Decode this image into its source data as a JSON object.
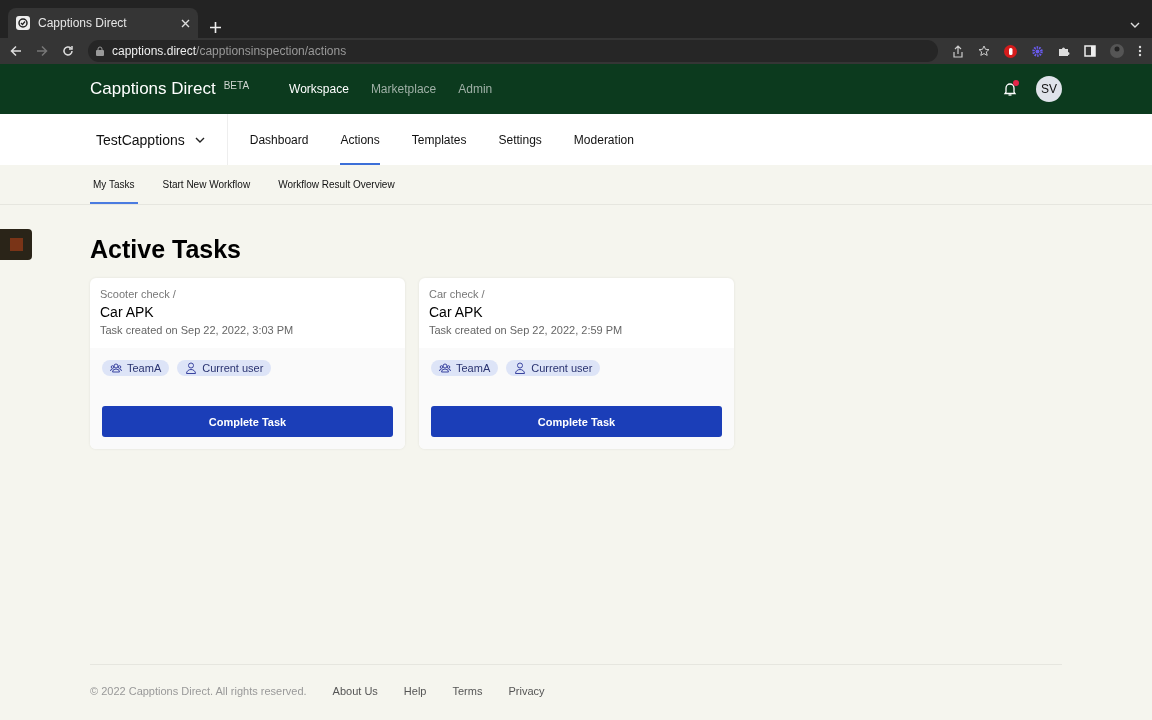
{
  "browser": {
    "tab_title": "Capptions Direct",
    "url_host": "capptions.direct",
    "url_path": "/capptionsinspection/actions"
  },
  "header": {
    "brand": "Capptions Direct",
    "badge": "BETA",
    "nav": [
      {
        "label": "Workspace",
        "selected": true
      },
      {
        "label": "Marketplace",
        "selected": false
      },
      {
        "label": "Admin",
        "selected": false
      }
    ],
    "notification_unread": true,
    "avatar": "SV"
  },
  "org": {
    "name": "TestCapptions"
  },
  "tabs": [
    {
      "label": "Dashboard",
      "selected": false
    },
    {
      "label": "Actions",
      "selected": true
    },
    {
      "label": "Templates",
      "selected": false
    },
    {
      "label": "Settings",
      "selected": false
    },
    {
      "label": "Moderation",
      "selected": false
    }
  ],
  "subtabs": [
    {
      "label": "My Tasks",
      "selected": true
    },
    {
      "label": "Start New Workflow",
      "selected": false
    },
    {
      "label": "Workflow Result Overview",
      "selected": false
    }
  ],
  "heading": "Active Tasks",
  "tasks": [
    {
      "workflow": "Scooter check /",
      "title": "Car APK",
      "created": "Task created on Sep 22, 2022, 3:03 PM",
      "assignees": [
        {
          "kind": "team",
          "label": "TeamA"
        },
        {
          "kind": "user",
          "label": "Current user"
        }
      ],
      "button": "Complete Task"
    },
    {
      "workflow": "Car check /",
      "title": "Car APK",
      "created": "Task created on Sep 22, 2022, 2:59 PM",
      "assignees": [
        {
          "kind": "team",
          "label": "TeamA"
        },
        {
          "kind": "user",
          "label": "Current user"
        }
      ],
      "button": "Complete Task"
    }
  ],
  "footer": {
    "copyright": "© 2022 Capptions Direct. All rights reserved.",
    "links": [
      "About Us",
      "Help",
      "Terms",
      "Privacy"
    ]
  }
}
